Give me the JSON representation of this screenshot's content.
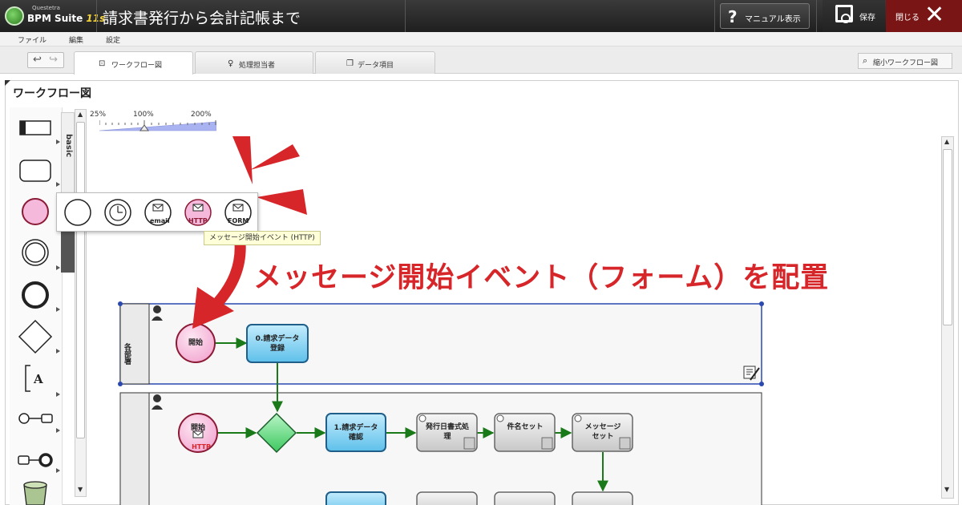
{
  "app": {
    "logo_small": "Questetra",
    "logo_name": "BPM Suite",
    "logo_version": "11s",
    "title": "請求書発行から会計記帳まで",
    "manual_label": "マニュアル表示",
    "save_label": "保存",
    "close_label": "閉じる"
  },
  "menu": {
    "file": "ファイル",
    "edit": "編集",
    "settings": "設定"
  },
  "tabs": [
    {
      "label": "ワークフロー図",
      "icon": "workflow-icon"
    },
    {
      "label": "処理担当者",
      "icon": "person-icon"
    },
    {
      "label": "データ項目",
      "icon": "data-icon"
    }
  ],
  "minimap_label": "縮小ワークフロー図",
  "panel_title": "ワークフロー図",
  "palette": {
    "tab_basic": "basic"
  },
  "zoom": {
    "min": "25%",
    "mid": "100%",
    "max": "200%",
    "level_percent": 100
  },
  "popup": {
    "items": [
      "",
      "",
      "email",
      "HTTP",
      "FORM"
    ],
    "tooltip": "メッセージ開始イベント (HTTP)"
  },
  "annotation": {
    "text": "メッセージ開始イベント（フォーム）を配置",
    "color": "#d7262a"
  },
  "diagram": {
    "lane1": {
      "label": "各部署"
    },
    "lane1_start": "開始",
    "lane1_task": [
      "0.請求データ",
      "登録"
    ],
    "lane2_start": "開始",
    "lane2_start_badge": "HTTP",
    "lane2_task1": [
      "1.請求データ",
      "確認"
    ],
    "lane2_task2": [
      "発行日書式処",
      "理"
    ],
    "lane2_task3": "件名セット",
    "lane2_task4": [
      "メッセージ",
      "セット"
    ]
  },
  "colors": {
    "start_fill": "#f9cfe6",
    "start_stroke": "#8b1a35",
    "task_fill": "#7fd0f2",
    "task_stroke": "#1f5f8a",
    "service_fill": "#dcdcdc",
    "gateway_fill": "#6fe08a",
    "flow": "#1a7a1a",
    "selection": "#2a49b0"
  }
}
